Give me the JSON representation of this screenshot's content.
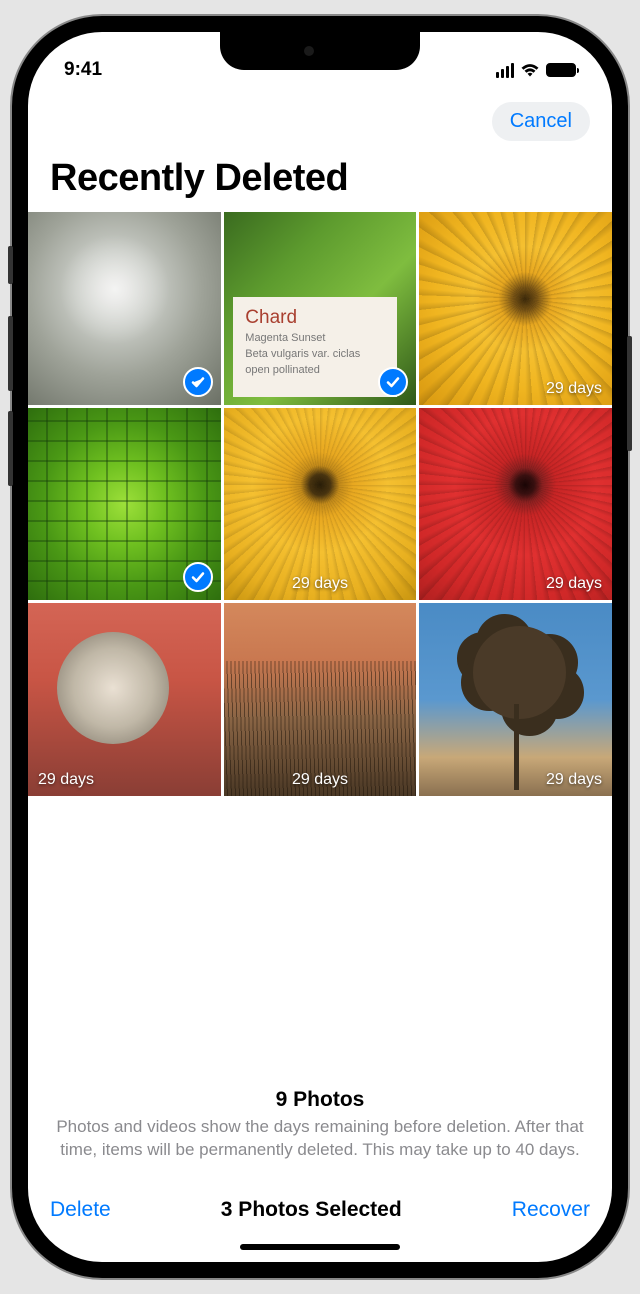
{
  "status": {
    "time": "9:41"
  },
  "nav": {
    "cancel": "Cancel"
  },
  "header": {
    "title": "Recently Deleted"
  },
  "grid": {
    "items": [
      {
        "days": "",
        "selected": true
      },
      {
        "days": "",
        "selected": true,
        "card_title": "Chard",
        "card_sub1": "Magenta Sunset",
        "card_sub2": "Beta vulgaris var. ciclas",
        "card_sub3": "open pollinated"
      },
      {
        "days": "29 days",
        "selected": false
      },
      {
        "days": "",
        "selected": true
      },
      {
        "days": "29 days",
        "selected": false
      },
      {
        "days": "29 days",
        "selected": false
      },
      {
        "days": "29 days",
        "selected": false
      },
      {
        "days": "29 days",
        "selected": false
      },
      {
        "days": "29 days",
        "selected": false
      }
    ]
  },
  "summary": {
    "count": "9 Photos",
    "info": "Photos and videos show the days remaining before deletion. After that time, items will be permanently deleted. This may take up to 40 days."
  },
  "bottom": {
    "delete": "Delete",
    "selected": "3 Photos Selected",
    "recover": "Recover"
  }
}
